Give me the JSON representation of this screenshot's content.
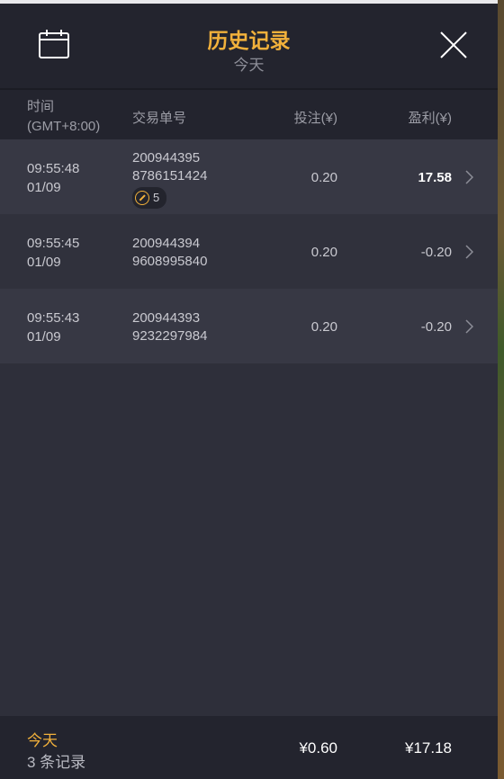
{
  "header": {
    "title": "历史记录",
    "subtitle": "今天",
    "calendar_icon": "calendar-icon",
    "close_icon": "close-icon"
  },
  "columns": {
    "time_line1": "时间",
    "time_line2": "(GMT+8:00)",
    "order": "交易单号",
    "bet": "投注(¥)",
    "profit": "盈利(¥)"
  },
  "rows": [
    {
      "time": "09:55:48",
      "date": "01/09",
      "order_line1": "200944395",
      "order_line2": "8786151424",
      "badge": "5",
      "bet": "0.20",
      "profit": "17.58"
    },
    {
      "time": "09:55:45",
      "date": "01/09",
      "order_line1": "200944394",
      "order_line2": "9608995840",
      "bet": "0.20",
      "profit": "-0.20"
    },
    {
      "time": "09:55:43",
      "date": "01/09",
      "order_line1": "200944393",
      "order_line2": "9232297984",
      "bet": "0.20",
      "profit": "-0.20"
    }
  ],
  "footer": {
    "label": "今天",
    "count": "3 条记录",
    "total_bet": "¥0.60",
    "total_profit": "¥17.18"
  },
  "colors": {
    "accent": "#f2b13b",
    "header_bg": "#23242e",
    "body_bg": "#2e2f3a"
  }
}
